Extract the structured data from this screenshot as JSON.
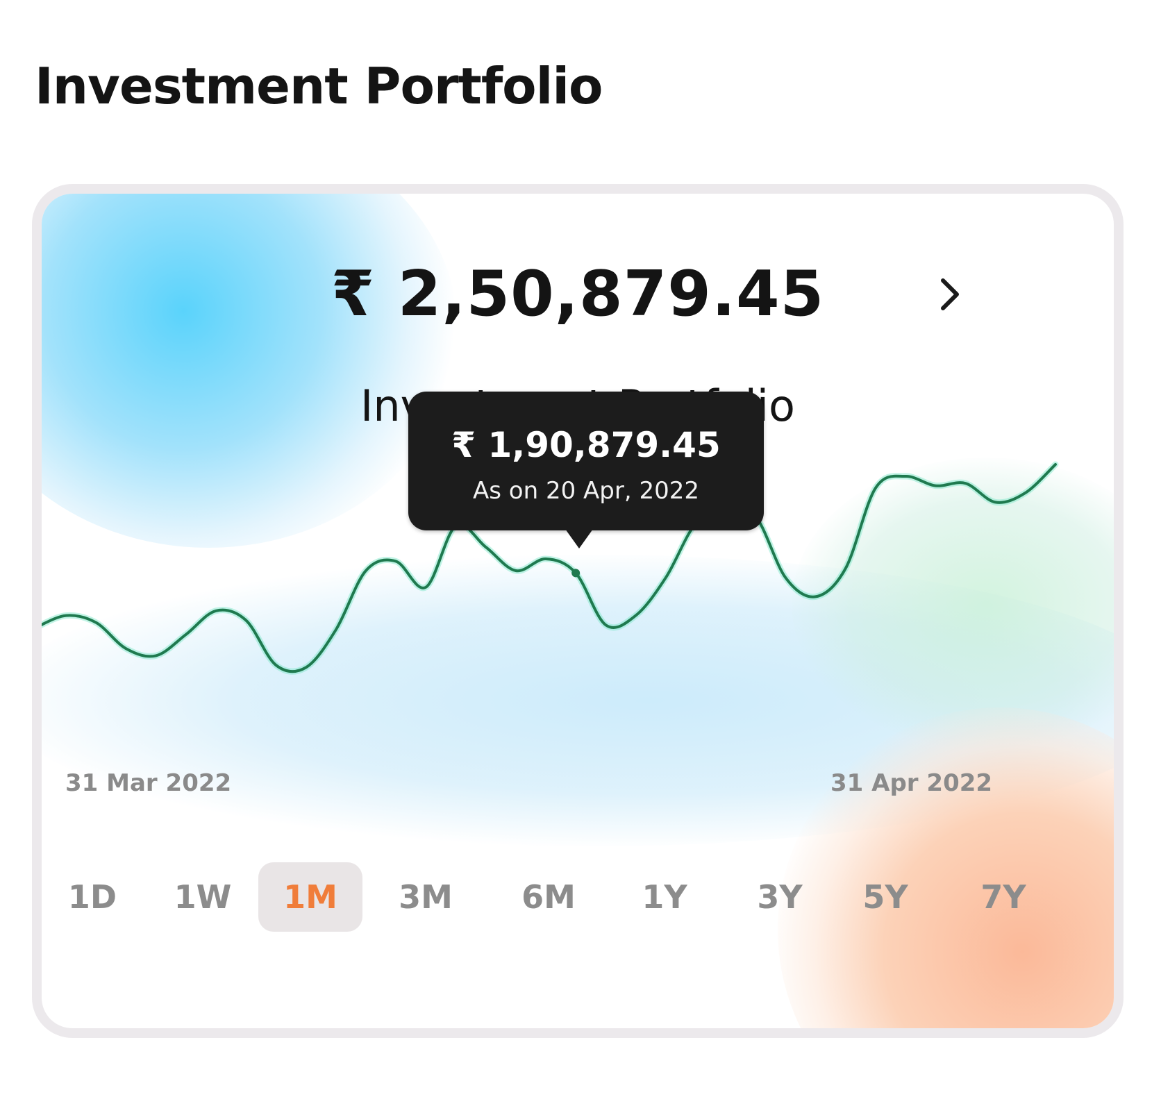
{
  "header": {
    "title": "Investment Portfolio"
  },
  "summary": {
    "total_value": "₹ 2,50,879.45",
    "subtitle": "Investment Portfolio",
    "chevron_icon": "chevron-right-icon"
  },
  "tooltip": {
    "value": "₹ 1,90,879.45",
    "date": "As on 20 Apr, 2022"
  },
  "axis": {
    "start_label": "31 Mar 2022",
    "end_label": "31 Apr 2022"
  },
  "chart_data": {
    "type": "line",
    "series": [
      {
        "values": [
          0.31,
          0.36,
          0.33,
          0.22,
          0.19,
          0.28,
          0.38,
          0.34,
          0.15,
          0.14,
          0.3,
          0.55,
          0.59,
          0.48,
          0.74,
          0.65,
          0.55,
          0.6,
          0.54,
          0.32,
          0.36,
          0.52,
          0.75,
          0.82,
          0.78,
          0.52,
          0.44,
          0.56,
          0.9,
          0.95,
          0.91,
          0.92,
          0.84,
          0.88,
          1.0
        ]
      }
    ],
    "highlighted_point": {
      "index": 18
    },
    "line_color": "#1f7a4f"
  },
  "ranges": [
    {
      "label": "1D",
      "active": false
    },
    {
      "label": "1W",
      "active": false
    },
    {
      "label": "1M",
      "active": true
    },
    {
      "label": "3M",
      "active": false
    },
    {
      "label": "6M",
      "active": false
    },
    {
      "label": "1Y",
      "active": false
    },
    {
      "label": "3Y",
      "active": false
    },
    {
      "label": "5Y",
      "active": false
    },
    {
      "label": "7Y",
      "active": false
    }
  ],
  "colors": {
    "active_range_text": "#f07d3a",
    "active_range_bg": "#e9e5e6",
    "line": "#1f7a4f"
  }
}
